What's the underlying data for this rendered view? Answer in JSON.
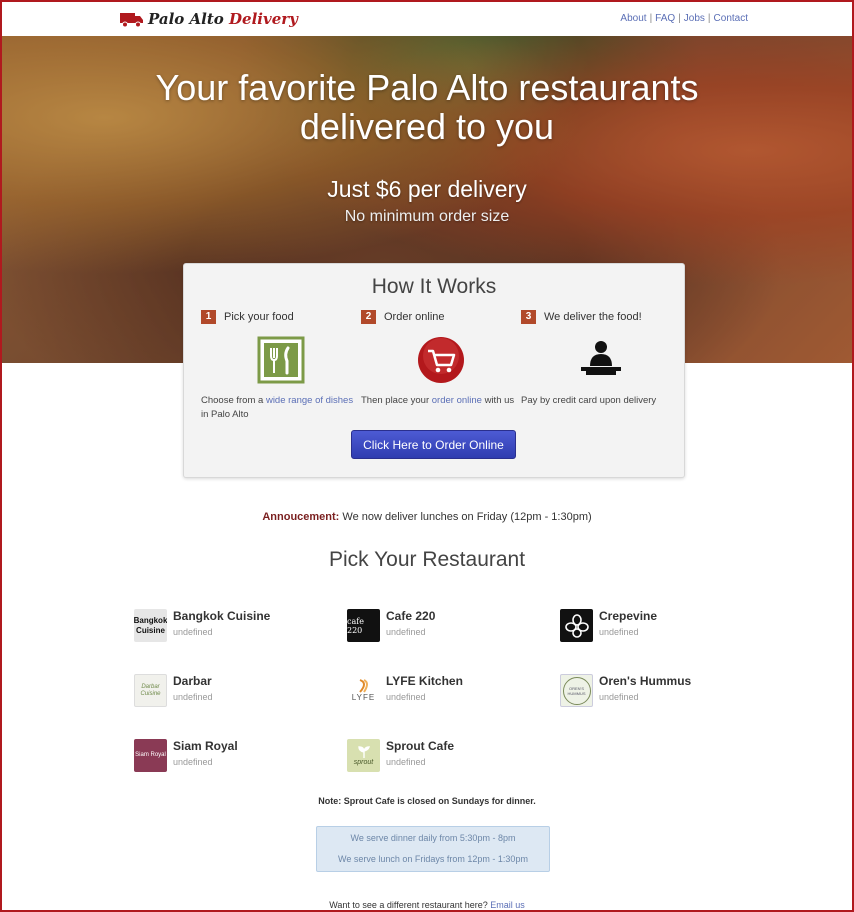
{
  "header": {
    "brand_left": "Palo Alto",
    "brand_right": "Delivery",
    "links": [
      "About",
      "FAQ",
      "Jobs",
      "Contact"
    ]
  },
  "hero": {
    "headline_line1": "Your favorite Palo Alto restaurants",
    "headline_line2": "delivered to you",
    "price": "Just $6 per delivery",
    "minimum": "No minimum order size"
  },
  "how_it_works": {
    "title": "How It Works",
    "steps": [
      {
        "number": "1",
        "title": "Pick your food",
        "desc_before": "Choose from a ",
        "desc_link": "wide range of dishes",
        "desc_after": " in Palo Alto"
      },
      {
        "number": "2",
        "title": "Order online",
        "desc_before": "Then place your ",
        "desc_link": "order online",
        "desc_after": " with us"
      },
      {
        "number": "3",
        "title": "We deliver the food!",
        "desc_before": "Pay by credit card upon delivery",
        "desc_link": "",
        "desc_after": ""
      }
    ],
    "order_button": "Click Here to Order Online"
  },
  "announcement": {
    "label": "Annoucement:",
    "text": " We now deliver lunches on Friday (12pm - 1:30pm)"
  },
  "restaurants_section": {
    "title": "Pick Your Restaurant",
    "items": [
      {
        "name": "Bangkok Cuisine",
        "sub": "undefined",
        "thumb_text": "Bangkok Cuisine"
      },
      {
        "name": "Cafe 220",
        "sub": "undefined",
        "thumb_text": "cafe 220"
      },
      {
        "name": "Crepevine",
        "sub": "undefined",
        "thumb_text": ""
      },
      {
        "name": "Darbar",
        "sub": "undefined",
        "thumb_text": "Darbar Cuisine"
      },
      {
        "name": "LYFE Kitchen",
        "sub": "undefined",
        "thumb_text": "LYFE"
      },
      {
        "name": "Oren's Hummus",
        "sub": "undefined",
        "thumb_text": "OREN'S HUMMUS"
      },
      {
        "name": "Siam Royal",
        "sub": "undefined",
        "thumb_text": "Siam Royal"
      },
      {
        "name": "Sprout Cafe",
        "sub": "undefined",
        "thumb_text": "sprout"
      }
    ],
    "note": "Note: Sprout Cafe is closed on Sundays for dinner."
  },
  "hours": {
    "dinner": "We serve dinner daily from 5:30pm - 8pm",
    "lunch": "We serve lunch on Fridays from 12pm - 1:30pm"
  },
  "footer": {
    "text": "Want to see a different restaurant here? ",
    "link": "Email us"
  },
  "colors": {
    "brand_red": "#b0191e",
    "link_blue": "#5b6fb6",
    "step_badge": "#b1492a",
    "button_blue": "#3b47c2"
  }
}
